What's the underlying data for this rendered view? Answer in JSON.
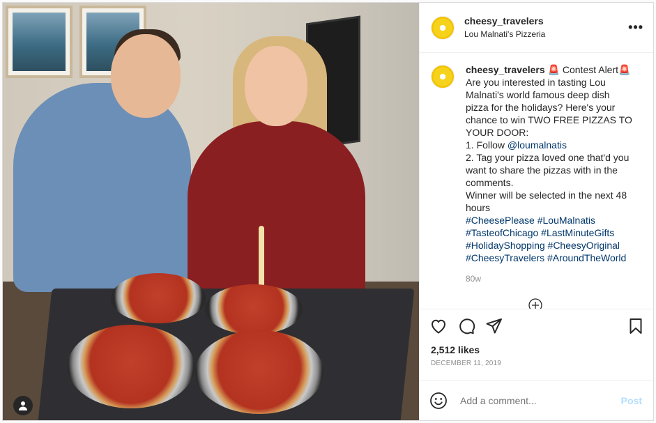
{
  "post": {
    "username": "cheesy_travelers",
    "location": "Lou Malnati's Pizzeria",
    "more_label": "•••",
    "caption_lines": [
      "🚨 Contest Alert🚨",
      "Are you interested in tasting Lou",
      "Malnati's world famous deep dish",
      "pizza for the holidays? Here's your",
      "chance to win TWO FREE PIZZAS TO",
      "YOUR DOOR:",
      "1. Follow ",
      "2. Tag your pizza loved one that'd you",
      "want to share the pizzas with in the",
      "comments.",
      "Winner will be selected in the next 48",
      "hours"
    ],
    "mention": "@loumalnatis",
    "hashtag_lines": [
      "#CheesePlease #LouMalnatis",
      "#TasteofChicago #LastMinuteGifts",
      "#HolidayShopping #CheesyOriginal",
      "#CheesyTravelers #AroundTheWorld"
    ],
    "age": "80w",
    "likes": "2,512 likes",
    "date": "DECEMBER 11, 2019",
    "comment_placeholder": "Add a comment...",
    "post_label": "Post"
  },
  "icons": {
    "like": "heart-icon",
    "comment": "comment-icon",
    "share": "paper-plane-icon",
    "save": "bookmark-icon",
    "emoji": "smiley-icon",
    "tag": "user-tag-icon",
    "more": "more-dots-icon",
    "loading": "loading-spinner-icon"
  },
  "colors": {
    "link": "#00376b",
    "muted": "#8e8e8e",
    "post_button": "#b2dffc"
  }
}
